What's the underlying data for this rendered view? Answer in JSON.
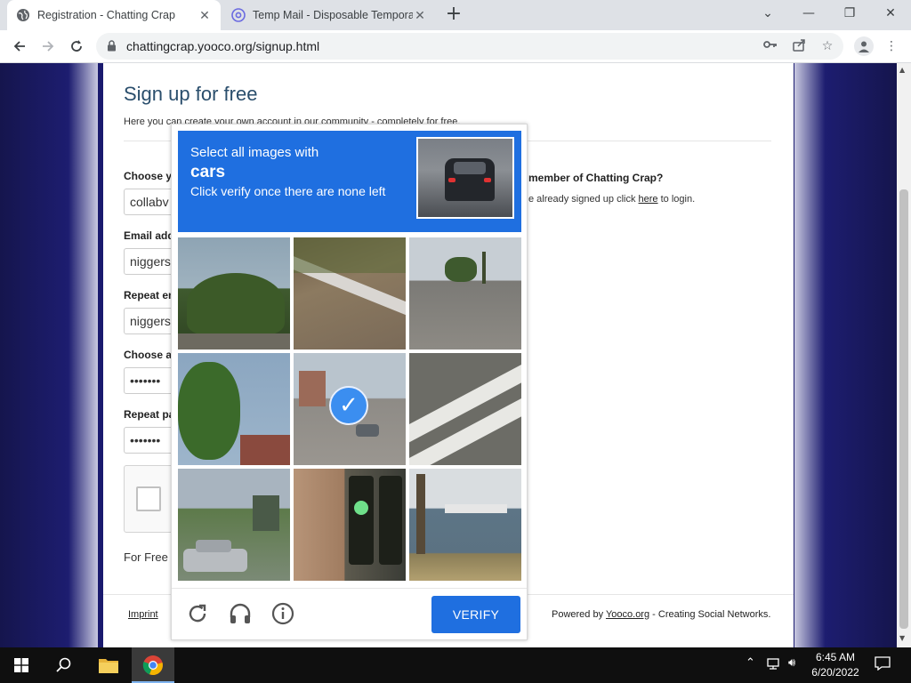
{
  "browser": {
    "tabs": [
      {
        "title": "Registration - Chatting Crap",
        "active": true
      },
      {
        "title": "Temp Mail - Disposable Tempora",
        "active": false
      }
    ],
    "url": "chattingcrap.yooco.org/signup.html"
  },
  "page": {
    "title": "Sign up for free",
    "subtitle": "Here you can create your own account in our community - completely for free.",
    "fields": [
      {
        "label": "Choose yo",
        "value": "collabv"
      },
      {
        "label": "Email add",
        "value": "niggers"
      },
      {
        "label": "Repeat en",
        "value": "niggers"
      },
      {
        "label": "Choose a",
        "value": "•••••••"
      },
      {
        "label": "Repeat pa",
        "value": "•••••••"
      }
    ],
    "for_free_text": "For Free",
    "member_title": "member of Chatting Crap?",
    "member_text_pre": "e already signed up click ",
    "member_link": "here",
    "member_text_post": " to login.",
    "footer_left": "Imprint",
    "footer_right_pre": "Powered by ",
    "footer_right_link": "Yooco.org",
    "footer_right_post": " - Creating Social Networks."
  },
  "captcha": {
    "line1": "Select all images with",
    "line2": "cars",
    "line3": "Click verify once there are none left",
    "verify_label": "VERIFY",
    "tiles": [
      {
        "desc": "tree-sky",
        "selected": false
      },
      {
        "desc": "road-barrier",
        "selected": false
      },
      {
        "desc": "road-palms",
        "selected": false
      },
      {
        "desc": "tree-roof",
        "selected": false
      },
      {
        "desc": "street-traffic-light",
        "selected": true
      },
      {
        "desc": "road-stripes",
        "selected": false
      },
      {
        "desc": "parked-car",
        "selected": false
      },
      {
        "desc": "pedestrian-signal",
        "selected": false
      },
      {
        "desc": "marina-boats",
        "selected": false
      }
    ]
  },
  "taskbar": {
    "time": "6:45 AM",
    "date": "6/20/2022"
  }
}
